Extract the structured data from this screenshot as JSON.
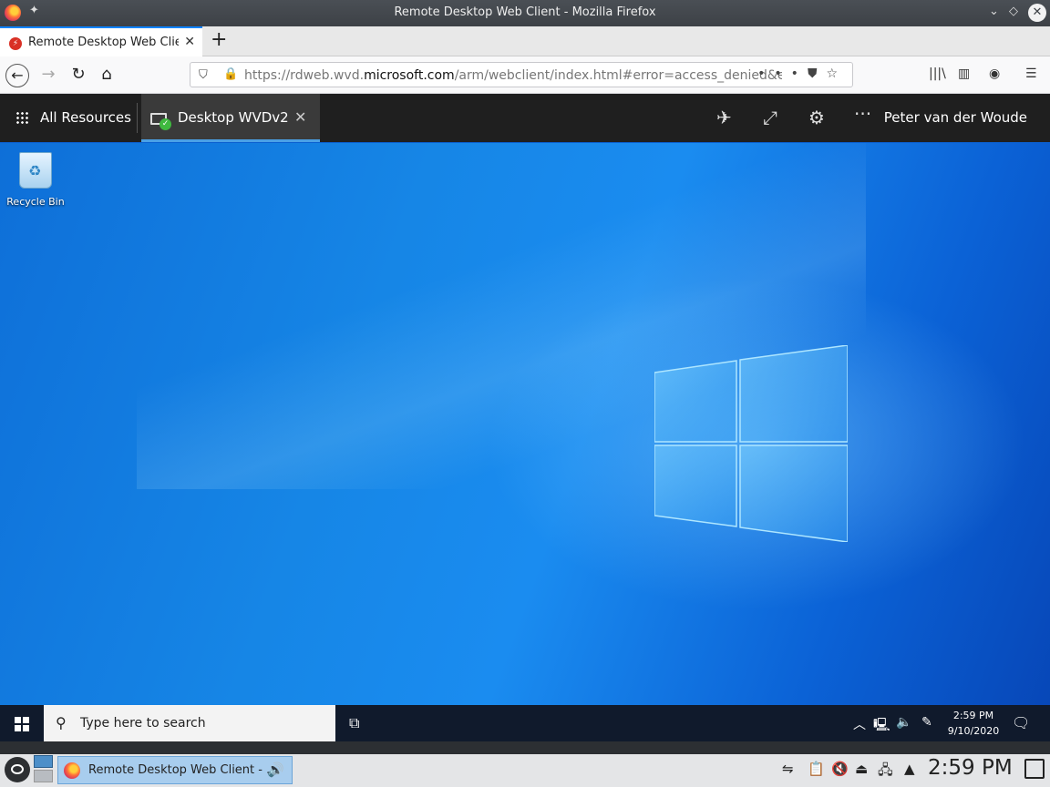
{
  "browser": {
    "window_title": "Remote Desktop Web Client - Mozilla Firefox",
    "tab_label": "Remote Desktop Web Client",
    "url_prefix": "https://rdweb.wvd.",
    "url_domain": "microsoft.com",
    "url_suffix": "/arm/webclient/index.html#error=access_denied&error",
    "url_full": "https://rdweb.wvd.microsoft.com/arm/webclient/index.html#error=access_denied&error"
  },
  "rdclient": {
    "all_resources_label": "All Resources",
    "session_tab_label": "Desktop WVDv2",
    "user_name": "Peter van der Woude"
  },
  "remote_desktop": {
    "recycle_bin_label": "Recycle Bin",
    "search_placeholder": "Type here to search",
    "clock_time": "2:59 PM",
    "clock_date": "9/10/2020"
  },
  "host_panel": {
    "task_label": "Remote Desktop Web Client - ...",
    "clock_time": "2:59 PM"
  },
  "colors": {
    "browser_accent": "#0a84ff",
    "rd_header_bg": "#1f1f1f",
    "session_tab_underline": "#4aa0e6",
    "connected_badge": "#3fb93f",
    "desktop_blue": "#1686e6"
  },
  "icons": {
    "firefox": "firefox-icon",
    "pin": "pin-icon",
    "back": "back-arrow-icon",
    "forward": "forward-arrow-icon",
    "reload": "reload-icon",
    "home": "home-icon",
    "shield": "tracking-shield-icon",
    "lock": "lock-icon",
    "page_actions": "more-dots-icon",
    "pocket": "pocket-icon",
    "bookmark": "star-icon",
    "library": "library-icon",
    "sidebar": "sidebar-icon",
    "account": "account-icon",
    "menu": "hamburger-menu-icon"
  }
}
